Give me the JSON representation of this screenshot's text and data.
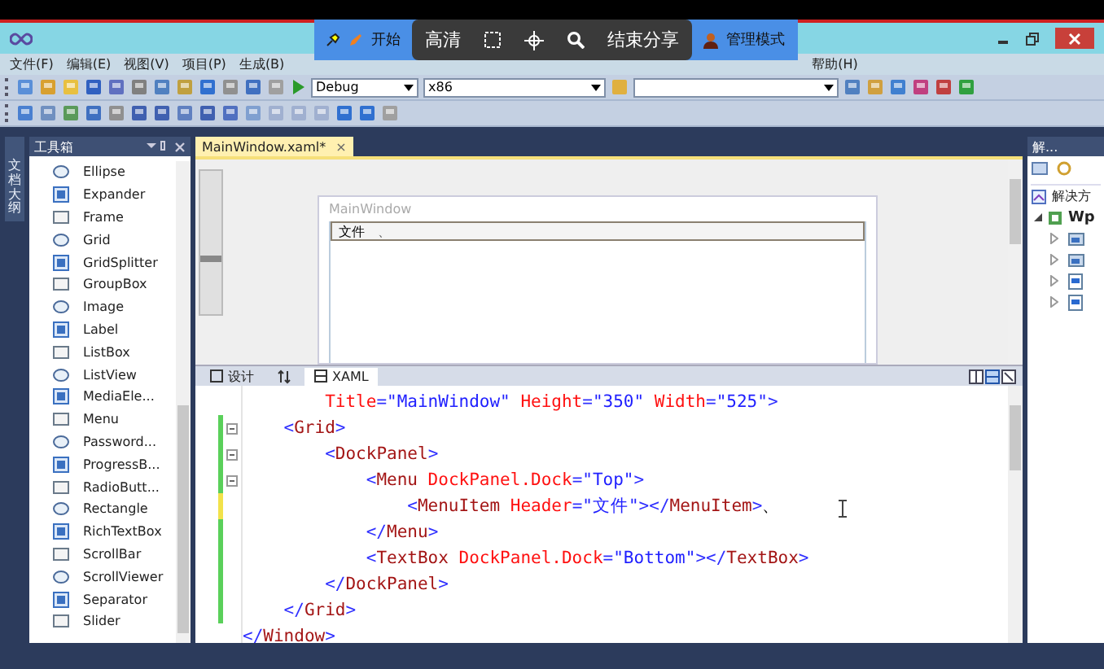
{
  "share_bar": {
    "start_label": "开始",
    "quality_label": "高清",
    "end_label": "结束分享",
    "admin_label": "管理模式"
  },
  "menus": [
    {
      "label": "文件(F)"
    },
    {
      "label": "编辑(E)"
    },
    {
      "label": "视图(V)"
    },
    {
      "label": "项目(P)"
    },
    {
      "label": "生成(B)"
    }
  ],
  "trailing_menus": [
    {
      "label": "帮助(H)"
    }
  ],
  "toolbar": {
    "configuration": "Debug",
    "platform": "x86"
  },
  "side_tab": {
    "label": "文档大纲"
  },
  "toolbox": {
    "title": "工具箱",
    "items": [
      {
        "label": "Ellipse"
      },
      {
        "label": "Expander"
      },
      {
        "label": "Frame"
      },
      {
        "label": "Grid"
      },
      {
        "label": "GridSplitter"
      },
      {
        "label": "GroupBox"
      },
      {
        "label": "Image"
      },
      {
        "label": "Label"
      },
      {
        "label": "ListBox"
      },
      {
        "label": "ListView"
      },
      {
        "label": "MediaEle..."
      },
      {
        "label": "Menu"
      },
      {
        "label": "Password..."
      },
      {
        "label": "ProgressB..."
      },
      {
        "label": "RadioButt..."
      },
      {
        "label": "Rectangle"
      },
      {
        "label": "RichTextBox"
      },
      {
        "label": "ScrollBar"
      },
      {
        "label": "ScrollViewer"
      },
      {
        "label": "Separator"
      },
      {
        "label": "Slider"
      }
    ]
  },
  "document_tab": {
    "title": "MainWindow.xaml*",
    "close": "×"
  },
  "designer": {
    "window_title": "MainWindow",
    "menu_item": "文件",
    "trailing_text": "、"
  },
  "view_tabs": [
    {
      "label": "设计",
      "kind": "design",
      "selected": false
    },
    {
      "kind": "swap",
      "selected": false
    },
    {
      "label": "XAML",
      "kind": "xaml",
      "selected": true
    }
  ],
  "code_lines": [
    {
      "changed": false,
      "unsaved": false,
      "collapsible": false,
      "tokens": [
        {
          "kind": "attr",
          "text": "        Title"
        },
        {
          "kind": "punct",
          "text": "="
        },
        {
          "kind": "val",
          "text": "\"MainWindow\""
        },
        {
          "kind": "attr",
          "text": " Height"
        },
        {
          "kind": "punct",
          "text": "="
        },
        {
          "kind": "val",
          "text": "\"350\""
        },
        {
          "kind": "attr",
          "text": " Width"
        },
        {
          "kind": "punct",
          "text": "="
        },
        {
          "kind": "val",
          "text": "\"525\""
        },
        {
          "kind": "punct",
          "text": ">"
        }
      ]
    },
    {
      "changed": true,
      "unsaved": false,
      "collapsible": true,
      "tokens": [
        {
          "kind": "punct",
          "text": "    <"
        },
        {
          "kind": "tag",
          "text": "Grid"
        },
        {
          "kind": "punct",
          "text": ">"
        }
      ]
    },
    {
      "changed": true,
      "unsaved": false,
      "collapsible": true,
      "tokens": [
        {
          "kind": "punct",
          "text": "        <"
        },
        {
          "kind": "tag",
          "text": "DockPanel"
        },
        {
          "kind": "punct",
          "text": ">"
        }
      ]
    },
    {
      "changed": true,
      "unsaved": false,
      "collapsible": true,
      "tokens": [
        {
          "kind": "punct",
          "text": "            <"
        },
        {
          "kind": "tag",
          "text": "Menu"
        },
        {
          "kind": "attr",
          "text": " DockPanel.Dock"
        },
        {
          "kind": "punct",
          "text": "="
        },
        {
          "kind": "val",
          "text": "\"Top\""
        },
        {
          "kind": "punct",
          "text": ">"
        }
      ]
    },
    {
      "changed": true,
      "unsaved": true,
      "collapsible": false,
      "tokens": [
        {
          "kind": "punct",
          "text": "                <"
        },
        {
          "kind": "tag",
          "text": "MenuItem"
        },
        {
          "kind": "attr",
          "text": " Header"
        },
        {
          "kind": "punct",
          "text": "="
        },
        {
          "kind": "val",
          "text": "\"文件\""
        },
        {
          "kind": "punct",
          "text": "></"
        },
        {
          "kind": "tag",
          "text": "MenuItem"
        },
        {
          "kind": "punct",
          "text": ">"
        },
        {
          "kind": "plain",
          "text": "、"
        }
      ]
    },
    {
      "changed": true,
      "unsaved": false,
      "collapsible": false,
      "tokens": [
        {
          "kind": "punct",
          "text": "            </"
        },
        {
          "kind": "tag",
          "text": "Menu"
        },
        {
          "kind": "punct",
          "text": ">"
        }
      ]
    },
    {
      "changed": true,
      "unsaved": false,
      "collapsible": false,
      "tokens": [
        {
          "kind": "punct",
          "text": "            <"
        },
        {
          "kind": "tag",
          "text": "TextBox"
        },
        {
          "kind": "attr",
          "text": " DockPanel.Dock"
        },
        {
          "kind": "punct",
          "text": "="
        },
        {
          "kind": "val",
          "text": "\"Bottom\""
        },
        {
          "kind": "punct",
          "text": "></"
        },
        {
          "kind": "tag",
          "text": "TextBox"
        },
        {
          "kind": "punct",
          "text": ">"
        }
      ]
    },
    {
      "changed": true,
      "unsaved": false,
      "collapsible": false,
      "tokens": [
        {
          "kind": "punct",
          "text": "        </"
        },
        {
          "kind": "tag",
          "text": "DockPanel"
        },
        {
          "kind": "punct",
          "text": ">"
        }
      ]
    },
    {
      "changed": true,
      "unsaved": false,
      "collapsible": false,
      "tokens": [
        {
          "kind": "punct",
          "text": "    </"
        },
        {
          "kind": "tag",
          "text": "Grid"
        },
        {
          "kind": "punct",
          "text": ">"
        }
      ]
    },
    {
      "changed": false,
      "unsaved": false,
      "collapsible": false,
      "tokens": [
        {
          "kind": "punct",
          "text": "</"
        },
        {
          "kind": "tag",
          "text": "Window"
        },
        {
          "kind": "punct",
          "text": ">"
        }
      ]
    }
  ],
  "solution_explorer": {
    "title": "解...",
    "root": "解决方",
    "project": "Wp",
    "children": [
      {
        "kind": "folder"
      },
      {
        "kind": "folder"
      },
      {
        "kind": "file"
      },
      {
        "kind": "file"
      }
    ]
  }
}
